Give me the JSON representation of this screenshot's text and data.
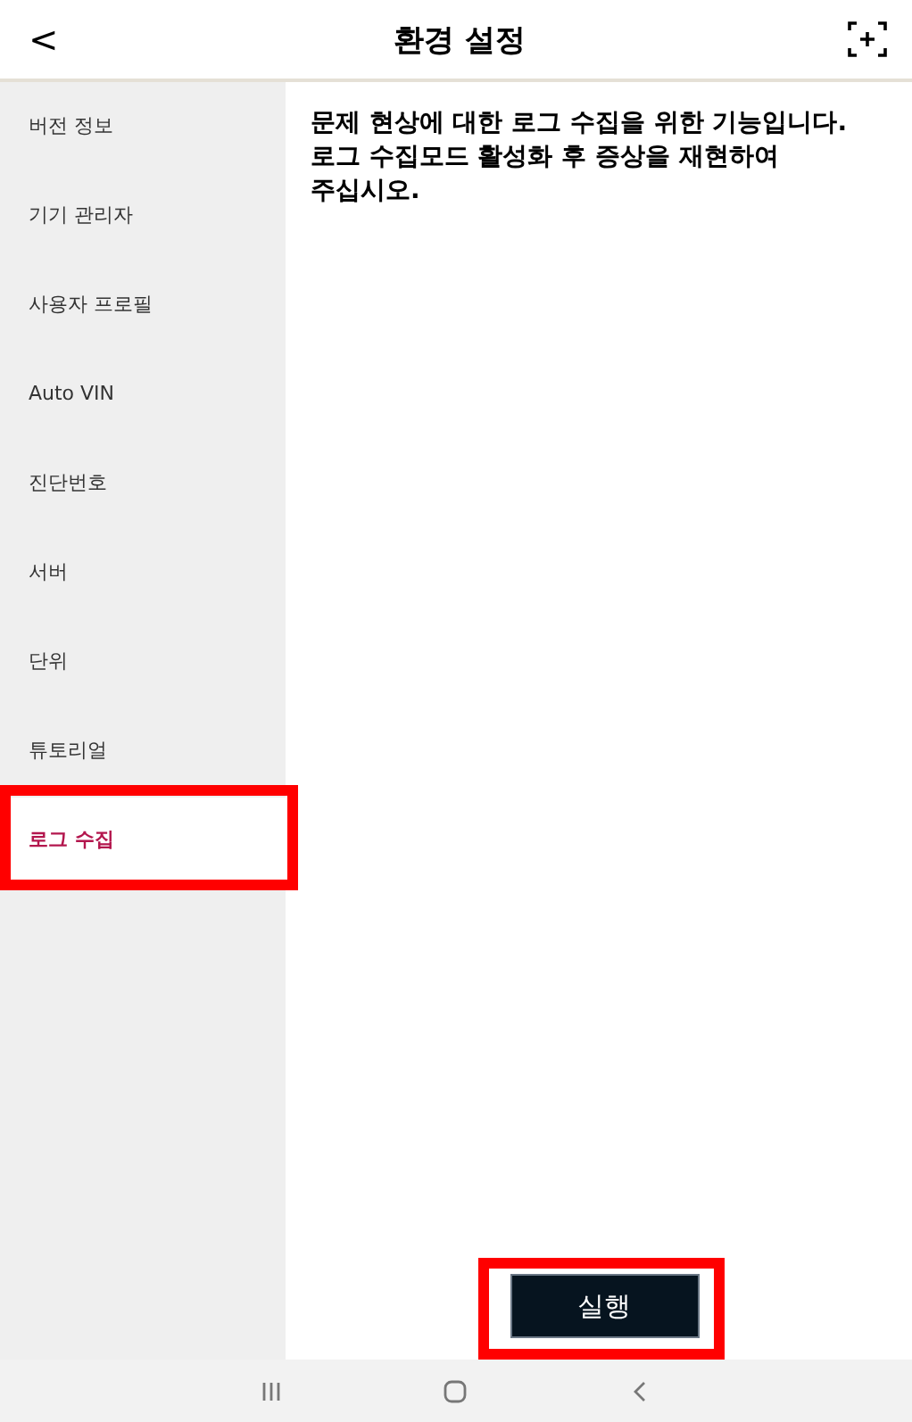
{
  "header": {
    "back": "<",
    "title": "환경 설정"
  },
  "sidebar": {
    "items": [
      {
        "label": "버전 정보",
        "selected": false,
        "highlighted": false
      },
      {
        "label": "기기 관리자",
        "selected": false,
        "highlighted": false
      },
      {
        "label": "사용자 프로필",
        "selected": false,
        "highlighted": false
      },
      {
        "label": "Auto VIN",
        "selected": false,
        "highlighted": false
      },
      {
        "label": "진단번호",
        "selected": false,
        "highlighted": false
      },
      {
        "label": "서버",
        "selected": false,
        "highlighted": false
      },
      {
        "label": "단위",
        "selected": false,
        "highlighted": false
      },
      {
        "label": "튜토리얼",
        "selected": false,
        "highlighted": false
      },
      {
        "label": "로그 수집",
        "selected": true,
        "highlighted": true
      }
    ]
  },
  "content": {
    "description": "문제 현상에 대한 로그 수집을 위한 기능입니다. 로그 수집모드 활성화 후 증상을 재현하여 주십시오.",
    "button": {
      "label": "실행",
      "highlighted": true
    }
  }
}
